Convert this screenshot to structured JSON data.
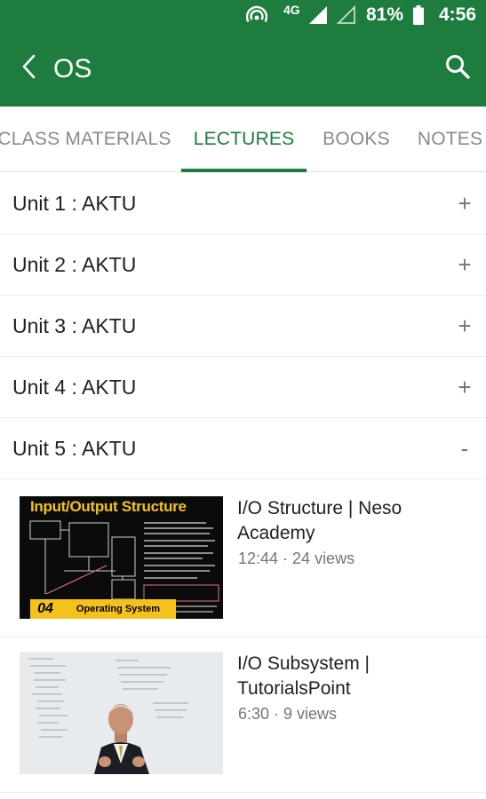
{
  "status_bar": {
    "network": "4G",
    "battery_percent": "81%",
    "time": "4:56"
  },
  "toolbar": {
    "title": "OS",
    "back_icon": "back-arrow-icon",
    "search_icon": "search-icon"
  },
  "tabs": [
    {
      "label": "CLASS MATERIALS",
      "active": false
    },
    {
      "label": "LECTURES",
      "active": true
    },
    {
      "label": "BOOKS",
      "active": false
    },
    {
      "label": "NOTES",
      "active": false
    }
  ],
  "units": [
    {
      "label": "Unit 1 : AKTU",
      "toggle": "+"
    },
    {
      "label": "Unit 2 : AKTU",
      "toggle": "+"
    },
    {
      "label": "Unit 3 : AKTU",
      "toggle": "+"
    },
    {
      "label": "Unit 4 : AKTU",
      "toggle": "+"
    },
    {
      "label": "Unit 5 : AKTU",
      "toggle": "-"
    }
  ],
  "videos": [
    {
      "title": "I/O Structure | Neso Academy",
      "meta": "12:44 · 24 views",
      "thumbnail": {
        "heading": "Input/Output Structure",
        "badge_number": "04",
        "badge_text": "Operating System"
      }
    },
    {
      "title": "I/O Subsystem | TutorialsPoint",
      "meta": "6:30 · 9 views",
      "thumbnail": {}
    }
  ],
  "colors": {
    "primary": "#1d7c3e",
    "tab_inactive": "#8a8a8a",
    "accent_yellow": "#f4c21a"
  }
}
